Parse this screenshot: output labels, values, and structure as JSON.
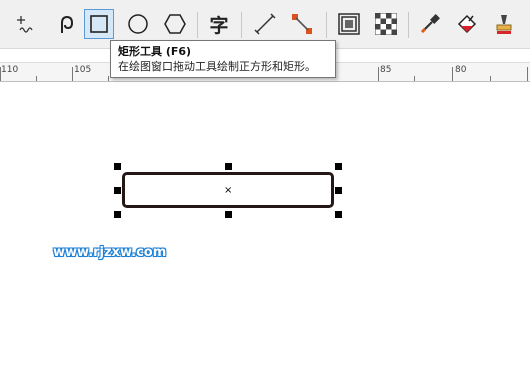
{
  "toolbar": {
    "tools": [
      {
        "name": "freehand-tool",
        "icon": "freehand-icon"
      },
      {
        "name": "artistic-media-tool",
        "icon": "spiral-pen-icon"
      },
      {
        "name": "rectangle-tool",
        "icon": "rectangle-icon",
        "active": true
      },
      {
        "name": "ellipse-tool",
        "icon": "ellipse-icon"
      },
      {
        "name": "polygon-tool",
        "icon": "hexagon-icon"
      },
      {
        "name": "text-tool",
        "icon": "text-icon",
        "glyph": "字"
      },
      {
        "name": "dimension-tool",
        "icon": "dimension-line-icon"
      },
      {
        "name": "connector-tool",
        "icon": "connector-icon"
      },
      {
        "name": "contour-tool",
        "icon": "contour-icon"
      },
      {
        "name": "transparency-tool",
        "icon": "checkerboard-icon"
      },
      {
        "name": "eyedropper-tool",
        "icon": "eyedropper-icon"
      },
      {
        "name": "fill-tool",
        "icon": "paint-bucket-icon"
      },
      {
        "name": "smart-fill-tool",
        "icon": "smart-fill-icon"
      }
    ]
  },
  "tooltip": {
    "title": "矩形工具 (F6)",
    "description": "在绘图窗口拖动工具绘制正方形和矩形。"
  },
  "ruler": {
    "labels": [
      "110",
      "105",
      "85",
      "80"
    ]
  },
  "watermark": {
    "text": "www.rjzxw.com"
  },
  "colors": {
    "accent": "#5b9bd5",
    "shape_outline": "#231815",
    "watermark": "#1a7fd6"
  }
}
